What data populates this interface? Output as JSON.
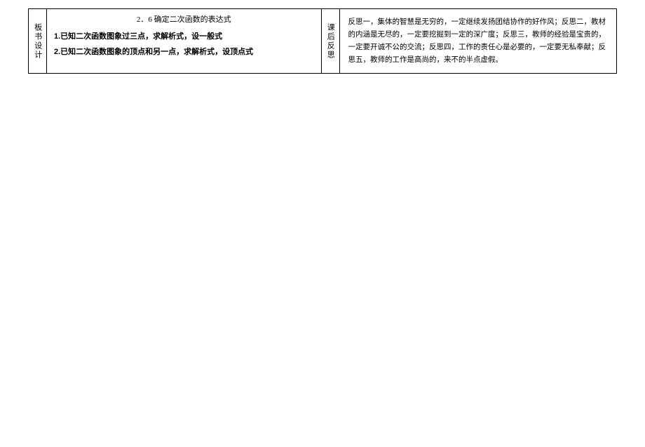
{
  "left": {
    "label": "板书设计",
    "title": "2．6 确定二次函数的表达式",
    "line1": "1.已知二次函数图象过三点，求解析式，设一般式",
    "line2": "2.已知二次函数图象的顶点和另一点，求解析式，设顶点式"
  },
  "right": {
    "label": "课后反思",
    "text": "反思一，集体的智慧是无穷的，一定继续发扬团结协作的好作风；反思二，教材的内涵是无尽的，一定要挖掘到一定的深广度；反思三，教师的经验是宝贵的，一定要开诚不公的交流；反思四，工作的责任心是必要的，一定要无私奉献；反思五，教师的工作是高尚的，来不的半点虚假。"
  }
}
